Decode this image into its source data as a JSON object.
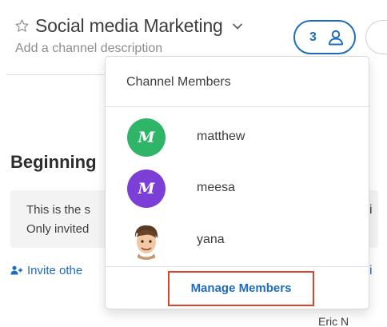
{
  "header": {
    "channel_title": "Social media Marketing",
    "channel_description": "Add a channel description",
    "member_count": "3"
  },
  "channel": {
    "beginning_heading": "Beginning",
    "intro_line1": "This is the s",
    "intro_line2": "Only invited",
    "invite_link": "Invite othe",
    "right_fragment_1": "i",
    "right_fragment_2": "i",
    "bottom_fragment": "Eric N"
  },
  "dropdown": {
    "title": "Channel Members",
    "members": [
      {
        "name": "matthew",
        "avatar_letter": "M",
        "avatar_color": "#2fb567"
      },
      {
        "name": "meesa",
        "avatar_letter": "M",
        "avatar_color": "#7b3ed6"
      },
      {
        "name": "yana",
        "avatar_letter": "",
        "avatar_color": "#ffffff",
        "avatar_type": "photo"
      }
    ],
    "manage_label": "Manage Members"
  },
  "colors": {
    "accent": "#1e6cc0",
    "highlight_border": "#d9442b",
    "muted_text": "#8b8d91"
  },
  "icons": [
    "star-icon",
    "chevron-down-icon",
    "person-icon",
    "add-user-icon"
  ]
}
